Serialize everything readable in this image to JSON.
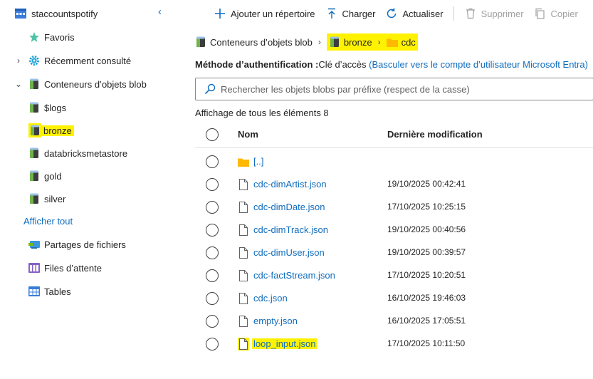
{
  "sidebar": {
    "account": "staccountspotify",
    "favorites": "Favoris",
    "recent": "Récemment consulté",
    "blob_containers": "Conteneurs d’objets blob",
    "containers": [
      "$logs",
      "bronze",
      "databricksmetastore",
      "gold",
      "silver"
    ],
    "show_all": "Afficher tout",
    "file_shares": "Partages de fichiers",
    "queues": "Files d’attente",
    "tables": "Tables"
  },
  "toolbar": {
    "add_directory": "Ajouter un répertoire",
    "upload": "Charger",
    "refresh": "Actualiser",
    "delete": "Supprimer",
    "copy": "Copier"
  },
  "breadcrumb": {
    "root": "Conteneurs d’objets blob",
    "container": "bronze",
    "folder": "cdc"
  },
  "auth": {
    "label": "Méthode d’authentification :",
    "value": "Clé d’accès",
    "link": "(Basculer vers le compte d’utilisateur Microsoft Entra)"
  },
  "search": {
    "placeholder": "Rechercher les objets blobs par préfixe (respect de la casse)"
  },
  "listing": {
    "count_text": "Affichage de tous les éléments 8",
    "col_name": "Nom",
    "col_modified": "Dernière modification",
    "rows": [
      {
        "name": "[..]",
        "modified": "",
        "type": "folder"
      },
      {
        "name": "cdc-dimArtist.json",
        "modified": "19/10/2025 00:42:41",
        "type": "file"
      },
      {
        "name": "cdc-dimDate.json",
        "modified": "17/10/2025 10:25:15",
        "type": "file"
      },
      {
        "name": "cdc-dimTrack.json",
        "modified": "19/10/2025 00:40:56",
        "type": "file"
      },
      {
        "name": "cdc-dimUser.json",
        "modified": "19/10/2025 00:39:57",
        "type": "file"
      },
      {
        "name": "cdc-factStream.json",
        "modified": "17/10/2025 10:20:51",
        "type": "file"
      },
      {
        "name": "cdc.json",
        "modified": "16/10/2025 19:46:03",
        "type": "file"
      },
      {
        "name": "empty.json",
        "modified": "16/10/2025 17:05:51",
        "type": "file"
      },
      {
        "name": "loop_input.json",
        "modified": "17/10/2025 10:11:50",
        "type": "file"
      }
    ]
  },
  "colors": {
    "link": "#0f6cbd",
    "highlight": "#fff200",
    "folder": "#ffb900"
  }
}
